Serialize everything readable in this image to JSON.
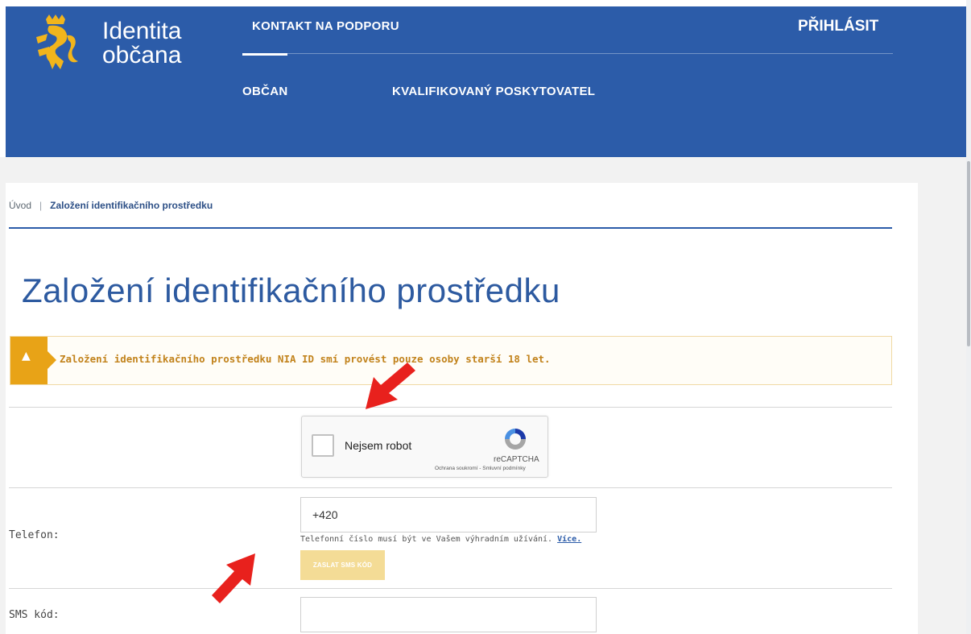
{
  "header": {
    "brand_line1": "Identita",
    "brand_line2": "občana",
    "support_link": "KONTAKT NA PODPORU",
    "login_label": "PŘIHLÁSIT",
    "nav": [
      {
        "label": "OBČAN"
      },
      {
        "label": "KVALIFIKOVANÝ POSKYTOVATEL"
      }
    ]
  },
  "breadcrumb": {
    "home": "Úvod",
    "separator": "|",
    "current": "Založení identifikačního prostředku"
  },
  "page": {
    "title": "Založení identifikačního prostředku"
  },
  "warning": {
    "icon": "warning-triangle-icon",
    "text": "Založení identifikačního prostředku NIA ID smí provést pouze osoby starší 18 let."
  },
  "captcha": {
    "label": "Nejsem robot",
    "brand": "reCAPTCHA",
    "links": "Ochrana soukromí - Smluvní podmínky"
  },
  "form": {
    "phone_label": "Telefon:",
    "phone_value": "+420",
    "phone_hint": "Telefonní číslo musí být ve Vašem výhradním užívání.",
    "phone_hint_link": "Více.",
    "send_sms_button": "ZASLAT SMS KÓD",
    "sms_label": "SMS kód:",
    "sms_value": ""
  },
  "colors": {
    "header_bg": "#2c5ca9",
    "title": "#2d5aa0",
    "warning_accent": "#e8a317",
    "annotation_arrow": "#e8211d"
  }
}
